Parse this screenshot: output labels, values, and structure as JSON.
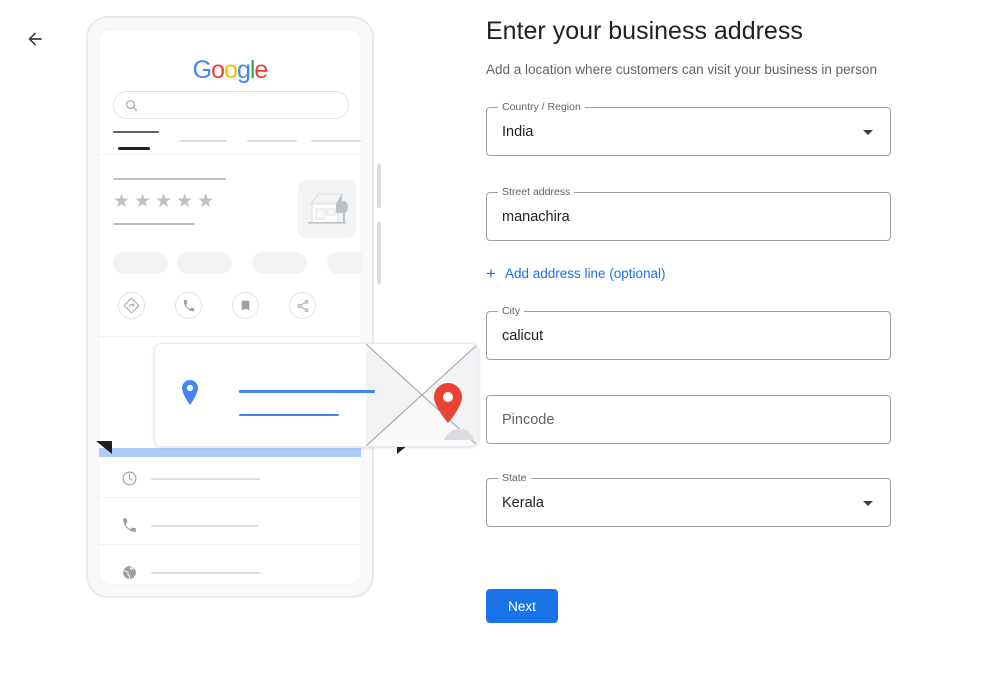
{
  "nav": {
    "back_label": "Back",
    "back_icon": "arrow-left-icon"
  },
  "header": {
    "title": "Enter your business address",
    "subtitle": "Add a location where customers can visit your business in person"
  },
  "form": {
    "fields": [
      {
        "name": "country-region",
        "label": "Country / Region",
        "value": "India",
        "type": "select",
        "has_label": true
      },
      {
        "name": "street-address",
        "label": "Street address",
        "value": "manachira",
        "type": "text",
        "has_label": true
      },
      {
        "name": "city",
        "label": "City",
        "value": "calicut",
        "type": "text",
        "has_label": true
      },
      {
        "name": "pincode",
        "label": "",
        "value": "",
        "placeholder": "Pincode",
        "type": "text",
        "has_label": false
      },
      {
        "name": "state",
        "label": "State",
        "value": "Kerala",
        "type": "select",
        "has_label": true
      }
    ],
    "add_address_line": {
      "label": "Add address line (optional)",
      "icon": "plus-icon"
    },
    "submit": {
      "label": "Next"
    }
  },
  "illustration": {
    "name": "google-business-phone-preview",
    "logo": {
      "text": "Google",
      "letters": [
        "G",
        "o",
        "o",
        "g",
        "l",
        "e"
      ],
      "colors": [
        "#4285f4",
        "#ea4335",
        "#fbbc05",
        "#4285f4",
        "#34a853",
        "#ea4335"
      ]
    },
    "search": {
      "icon": "search-icon"
    },
    "rating": {
      "stars": "★★★★★",
      "count": 5
    },
    "thumbnail": {
      "icon": "storefront-icon"
    },
    "actions": [
      {
        "name": "directions",
        "icon": "directions-icon"
      },
      {
        "name": "call",
        "icon": "phone-icon"
      },
      {
        "name": "save",
        "icon": "bookmark-icon"
      },
      {
        "name": "share",
        "icon": "share-icon"
      }
    ],
    "info_rows": [
      {
        "name": "hours",
        "icon": "clock-icon"
      },
      {
        "name": "phone",
        "icon": "phone-icon"
      },
      {
        "name": "website",
        "icon": "globe-icon"
      }
    ],
    "map_card": {
      "pin_icon": "map-pin-icon",
      "marker_icon": "map-marker-icon"
    }
  },
  "colors": {
    "accent": "#1a73e8",
    "link": "#1a73e8",
    "text_primary": "#202124",
    "text_secondary": "#5f6368",
    "border": "#9aa0a6",
    "marker_red": "#ea4335",
    "pin_blue": "#4285f4"
  }
}
